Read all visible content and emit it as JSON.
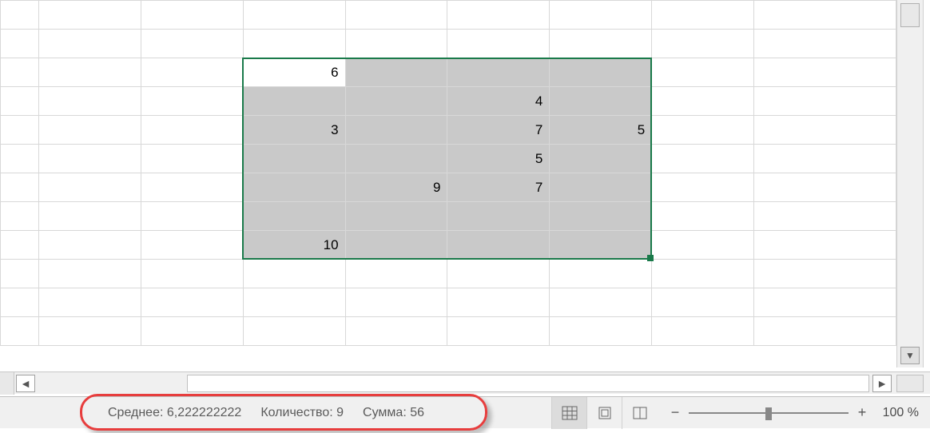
{
  "grid": {
    "columns": 9,
    "rows": 12,
    "col_widths": [
      "48px",
      "128px",
      "128px",
      "128px",
      "128px",
      "128px",
      "128px",
      "128px",
      "178px"
    ],
    "selection": {
      "r1": 2,
      "c1": 3,
      "r2": 8,
      "c2": 6,
      "active_r": 2,
      "active_c": 3
    },
    "cells": {
      "2,3": "6",
      "3,5": "4",
      "4,3": "3",
      "4,5": "7",
      "4,6": "5",
      "5,5": "5",
      "6,4": "9",
      "6,5": "7",
      "8,3": "10"
    }
  },
  "status": {
    "avg_label": "Среднее:",
    "avg_value": "6,222222222",
    "count_label": "Количество:",
    "count_value": "9",
    "sum_label": "Сумма:",
    "sum_value": "56"
  },
  "zoom": {
    "minus": "−",
    "plus": "+",
    "percent": "100 %"
  },
  "icons": {
    "left_arrow": "◄",
    "right_arrow": "►",
    "down_arrow": "▼"
  }
}
